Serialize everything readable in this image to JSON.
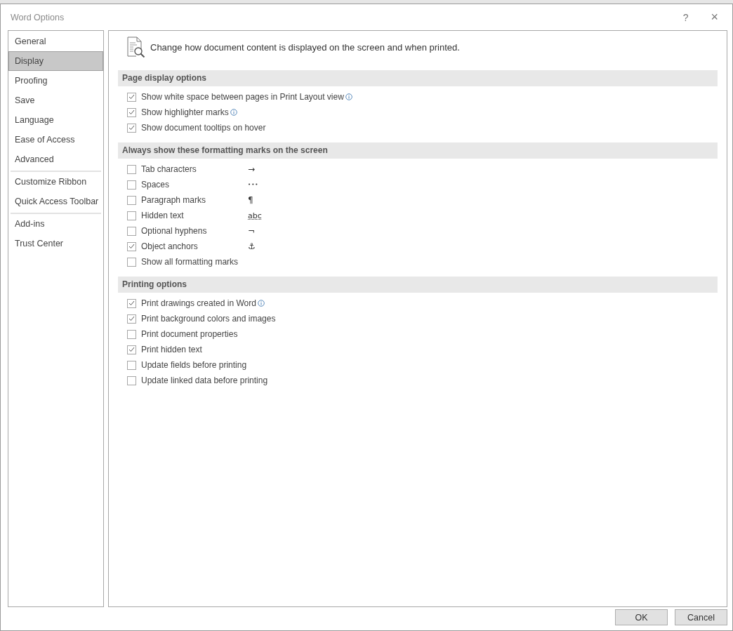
{
  "window": {
    "title": "Word Options",
    "help": "?",
    "close": "×"
  },
  "sidebar": {
    "groups": [
      {
        "items": [
          {
            "label": "General",
            "selected": false
          },
          {
            "label": "Display",
            "selected": true
          },
          {
            "label": "Proofing",
            "selected": false
          },
          {
            "label": "Save",
            "selected": false
          },
          {
            "label": "Language",
            "selected": false
          },
          {
            "label": "Ease of Access",
            "selected": false
          },
          {
            "label": "Advanced",
            "selected": false
          }
        ]
      },
      {
        "items": [
          {
            "label": "Customize Ribbon",
            "selected": false
          },
          {
            "label": "Quick Access Toolbar",
            "selected": false
          }
        ]
      },
      {
        "items": [
          {
            "label": "Add-ins",
            "selected": false
          },
          {
            "label": "Trust Center",
            "selected": false
          }
        ]
      }
    ]
  },
  "header": {
    "text": "Change how document content is displayed on the screen and when printed."
  },
  "sections": [
    {
      "title": "Page display options",
      "options": [
        {
          "label": "Show white space between pages in Print Layout view",
          "checked": true,
          "info": true
        },
        {
          "label": "Show highlighter marks",
          "checked": true,
          "info": true
        },
        {
          "label": "Show document tooltips on hover",
          "checked": true,
          "info": false
        }
      ]
    },
    {
      "title": "Always show these formatting marks on the screen",
      "options": [
        {
          "label": "Tab characters",
          "checked": false,
          "info": false,
          "symbol": "→"
        },
        {
          "label": "Spaces",
          "checked": false,
          "info": false,
          "symbol": "•••"
        },
        {
          "label": "Paragraph marks",
          "checked": false,
          "info": false,
          "symbol": "¶"
        },
        {
          "label": "Hidden text",
          "checked": false,
          "info": false,
          "symbol": "abc"
        },
        {
          "label": "Optional hyphens",
          "checked": false,
          "info": false,
          "symbol": "¬"
        },
        {
          "label": "Object anchors",
          "checked": true,
          "info": false,
          "symbol": "⚓"
        },
        {
          "label": "Show all formatting marks",
          "checked": false,
          "info": false
        }
      ]
    },
    {
      "title": "Printing options",
      "options": [
        {
          "label": "Print drawings created in Word",
          "checked": true,
          "info": true
        },
        {
          "label": "Print background colors and images",
          "checked": true,
          "info": false
        },
        {
          "label": "Print document properties",
          "checked": false,
          "info": false
        },
        {
          "label": "Print hidden text",
          "checked": true,
          "info": false
        },
        {
          "label": "Update fields before printing",
          "checked": false,
          "info": false
        },
        {
          "label": "Update linked data before printing",
          "checked": false,
          "info": false
        }
      ]
    }
  ],
  "buttons": [
    "OK",
    "Cancel"
  ]
}
